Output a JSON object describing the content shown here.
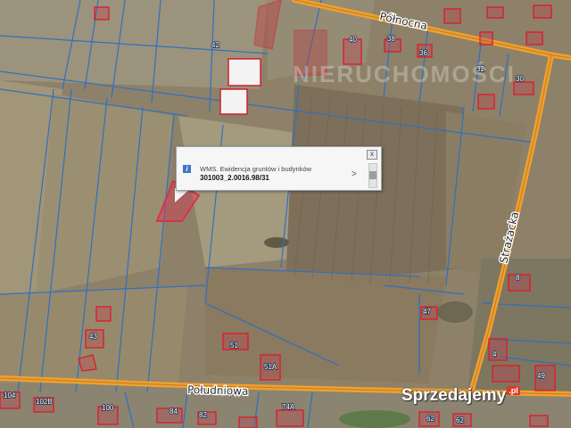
{
  "roads": [
    {
      "name": "Północna"
    },
    {
      "name": "Strażacka"
    },
    {
      "name": "Południowa"
    }
  ],
  "parcel_numbers": [
    "42",
    "40",
    "38",
    "36",
    "32",
    "30",
    "8",
    "47",
    "51",
    "51A",
    "43",
    "4",
    "49",
    "104",
    "102B",
    "100",
    "84",
    "82",
    "74A",
    "62",
    "62"
  ],
  "popup": {
    "title": "WMS. Ewidencja gruntów i budynków",
    "value": "301003_2.0016.98/31",
    "info_icon": "i",
    "next_arrow": ">",
    "close_icon": "x"
  },
  "watermark": "NIERUCHOMOŚCI",
  "brand": {
    "name": "Sprzedajemy",
    "tld": ".pl"
  },
  "colors": {
    "road": "#f0a030",
    "parcel_boundary": "#2f6fc4",
    "building_outline": "#e0182a",
    "selected_parcel": "#d8324d"
  }
}
